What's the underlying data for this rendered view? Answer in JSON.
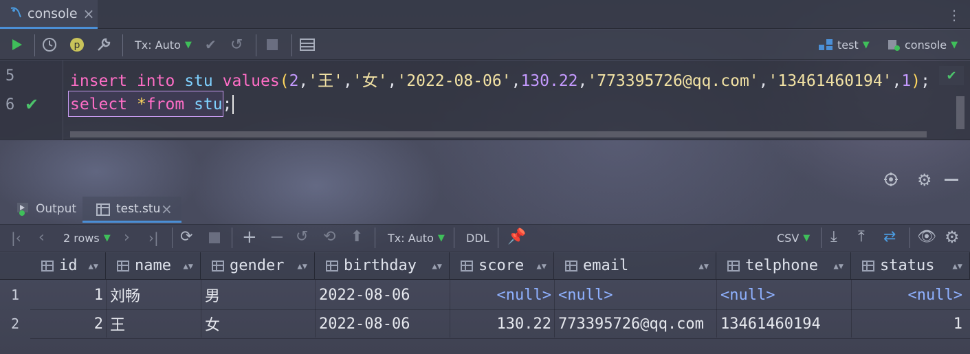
{
  "tabbar": {
    "console_tab": "console",
    "close": "×"
  },
  "toolbar": {
    "tx_mode": "Tx: Auto",
    "datasource": "test",
    "session": "console"
  },
  "editor": {
    "lines": [
      {
        "number": "5",
        "tokens": [
          {
            "t": "insert",
            "c": "kw"
          },
          {
            "t": " ",
            "c": "pun"
          },
          {
            "t": "into",
            "c": "kw"
          },
          {
            "t": " ",
            "c": "pun"
          },
          {
            "t": "stu",
            "c": "id"
          },
          {
            "t": " ",
            "c": "pun"
          },
          {
            "t": "values",
            "c": "kw"
          },
          {
            "t": "(",
            "c": "paren"
          },
          {
            "t": "2",
            "c": "num"
          },
          {
            "t": ",",
            "c": "pun"
          },
          {
            "t": "'王'",
            "c": "str"
          },
          {
            "t": ",",
            "c": "pun"
          },
          {
            "t": "'女'",
            "c": "str"
          },
          {
            "t": ",",
            "c": "pun"
          },
          {
            "t": "'2022-08-06'",
            "c": "str"
          },
          {
            "t": ",",
            "c": "pun"
          },
          {
            "t": "130.22",
            "c": "num"
          },
          {
            "t": ",",
            "c": "pun"
          },
          {
            "t": "'773395726@qq.com'",
            "c": "str"
          },
          {
            "t": ",",
            "c": "pun"
          },
          {
            "t": "'13461460194'",
            "c": "str"
          },
          {
            "t": ",",
            "c": "pun"
          },
          {
            "t": "1",
            "c": "num"
          },
          {
            "t": ")",
            "c": "paren"
          },
          {
            "t": ";",
            "c": "pun"
          }
        ]
      },
      {
        "number": "6",
        "tokens": [
          {
            "t": "select",
            "c": "kw"
          },
          {
            "t": " ",
            "c": "pun"
          },
          {
            "t": "*",
            "c": "paren"
          },
          {
            "t": "from",
            "c": "kw"
          },
          {
            "t": " ",
            "c": "pun"
          },
          {
            "t": "stu",
            "c": "id"
          },
          {
            "t": ";",
            "c": "pun"
          }
        ]
      }
    ]
  },
  "panel": {
    "output_tab": "Output",
    "result_tab": "test.stu",
    "close": "×"
  },
  "results_toolbar": {
    "rows": "2 rows",
    "tx_mode": "Tx: Auto",
    "ddl": "DDL",
    "export": "CSV"
  },
  "table": {
    "columns": [
      "id",
      "name",
      "gender",
      "birthday",
      "score",
      "email",
      "telphone",
      "status"
    ],
    "rows": [
      {
        "num": "1",
        "id": "1",
        "name": "刘畅",
        "gender": "男",
        "birthday": "2022-08-06",
        "score": "<null>",
        "email": "<null>",
        "telphone": "<null>",
        "status": "<null>"
      },
      {
        "num": "2",
        "id": "2",
        "name": "王",
        "gender": "女",
        "birthday": "2022-08-06",
        "score": "130.22",
        "email": "773395726@qq.com",
        "telphone": "13461460194",
        "status": "1"
      }
    ]
  },
  "colors": {
    "keyword": "#ff6ec7",
    "identifier": "#7fd1ff",
    "string": "#f2e2a4",
    "number": "#c59aff",
    "null": "#8fb1ff",
    "success": "#4cc36b",
    "accent": "#4b8fd6"
  }
}
